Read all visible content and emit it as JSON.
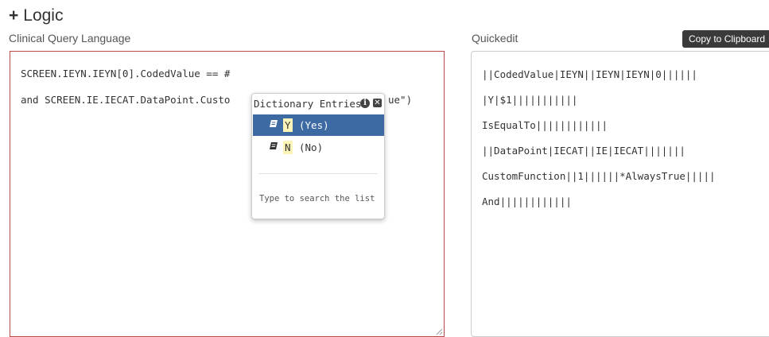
{
  "section": {
    "title": "Logic"
  },
  "cql": {
    "label": "Clinical Query Language",
    "lines": [
      "SCREEN.IEYN.IEYN[0].CodedValue == #",
      "and SCREEN.IE.IECAT.DataPoint.Custo",
      "ue\")"
    ]
  },
  "quickedit": {
    "label": "Quickedit",
    "copy_label": "Copy to Clipboard",
    "lines": [
      "||CodedValue|IEYN||IEYN|IEYN|0||||||",
      "|Y|$1|||||||||||",
      "IsEqualTo||||||||||||",
      "||DataPoint|IECAT||IE|IECAT|||||||",
      "CustomFunction||1||||||*AlwaysTrue|||||",
      "And||||||||||||"
    ]
  },
  "dictionary": {
    "title": "Dictionary Entries",
    "entries": [
      {
        "code": "Y",
        "desc": "(Yes)",
        "selected": true
      },
      {
        "code": "N",
        "desc": "(No)",
        "selected": false
      }
    ],
    "hint": "Type to search the list"
  },
  "colors": {
    "error_border": "#b94a48",
    "selected_bg": "#3d6aa3",
    "highlight": "#fcf3b8"
  }
}
